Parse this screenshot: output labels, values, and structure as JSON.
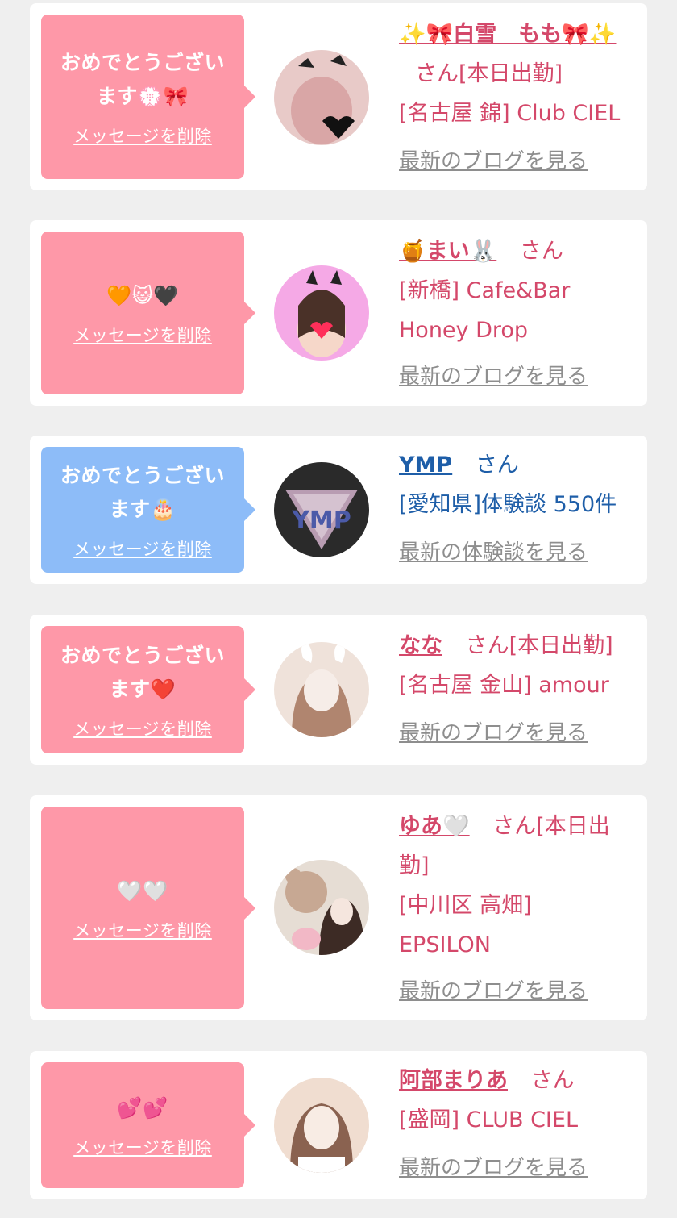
{
  "cards": [
    {
      "bubble_text": "おめでとうございます💮🎀",
      "delete_label": "メッセージを削除",
      "name": "✨🎀白雪　もも🎀✨",
      "suffix": "さん[本日出勤]",
      "shop": "[名古屋 錦] Club CIEL",
      "link": "最新のブログを見る",
      "avatar_colors": [
        "#e9c8c6",
        "#d9a2a3"
      ]
    },
    {
      "bubble_text": "🧡😺🖤",
      "delete_label": "メッセージを削除",
      "name": "🍯まい🐰",
      "suffix": "さん",
      "shop": "[新橋] Cafe&Bar Honey Drop",
      "link": "最新のブログを見る",
      "avatar_colors": [
        "#f8b0e8",
        "#e46fd0"
      ]
    },
    {
      "bubble_text": "おめでとうございます🎂",
      "delete_label": "メッセージを削除",
      "name": "YMP",
      "suffix": "さん",
      "shop": "[愛知県]体験談 550件",
      "link": "最新の体験談を見る",
      "avatar_colors": [
        "#2b2b2b",
        "#c8a9c6"
      ]
    },
    {
      "bubble_text": "おめでとうございます❤️",
      "delete_label": "メッセージを削除",
      "name": "なな",
      "suffix": "さん[本日出勤]",
      "shop": "[名古屋 金山] amour",
      "link": "最新のブログを見る",
      "avatar_colors": [
        "#f3e4dd",
        "#b48d7a"
      ]
    },
    {
      "bubble_text": "🤍🤍",
      "delete_label": "メッセージを削除",
      "name": "ゆあ🤍",
      "suffix": "さん[本日出勤]",
      "shop": "[中川区 高畑] EPSILON",
      "link": "最新のブログを見る",
      "avatar_colors": [
        "#e9dfd6",
        "#c7a892"
      ]
    },
    {
      "bubble_text": "💕💕",
      "delete_label": "メッセージを削除",
      "name": "阿部まりあ",
      "suffix": "さん",
      "shop": "[盛岡] CLUB CIEL",
      "link": "最新のブログを見る",
      "avatar_colors": [
        "#f1dccf",
        "#a97d63"
      ]
    }
  ]
}
